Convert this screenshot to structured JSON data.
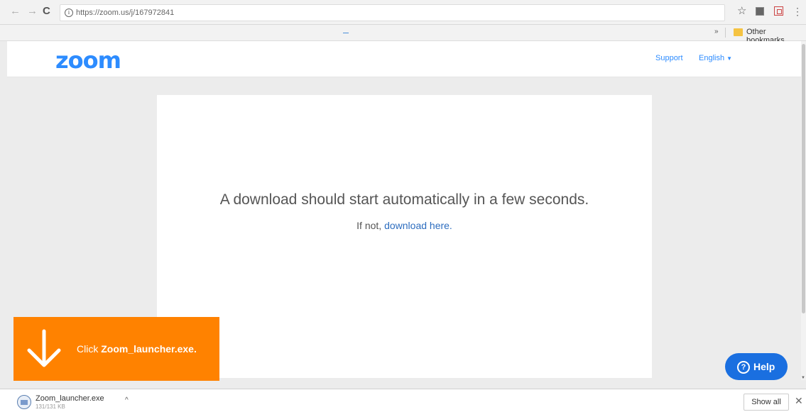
{
  "browser": {
    "url": "https://zoom.us/j/167972841",
    "bookmarks_more": "»",
    "other_bookmarks": "Other bookmarks"
  },
  "header": {
    "logo": "zoom",
    "support": "Support",
    "language": "English"
  },
  "main": {
    "message": "A download should start automatically in a few seconds.",
    "fallback_prefix": "If not,",
    "fallback_link": "download here."
  },
  "toast": {
    "prefix": "Click",
    "filename": "Zoom_launcher.exe."
  },
  "help": {
    "label": "Help"
  },
  "downloads": {
    "file_name": "Zoom_launcher.exe",
    "file_size": "131/131 KB",
    "show_all": "Show all"
  },
  "colors": {
    "brand_blue": "#2d8cff",
    "toast_orange": "#ff8200",
    "help_blue": "#1a6fe0"
  },
  "icons": [
    "back-arrow-icon",
    "forward-arrow-icon",
    "reload-icon",
    "info-icon",
    "star-icon",
    "extension-icon",
    "menu-icon",
    "folder-icon",
    "download-arrow-icon",
    "help-icon",
    "file-icon",
    "close-icon"
  ]
}
